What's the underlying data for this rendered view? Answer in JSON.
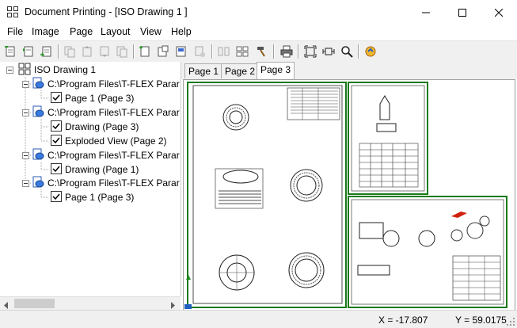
{
  "window": {
    "title": "Document Printing - [ISO Drawing 1 ]"
  },
  "menu": [
    "File",
    "Image",
    "Page",
    "Layout",
    "View",
    "Help"
  ],
  "tree": {
    "root": "ISO Drawing 1",
    "items": [
      {
        "label": "C:\\Program Files\\T-FLEX Parar",
        "type": "document"
      },
      {
        "label": "Page 1 (Page 3)",
        "type": "page"
      },
      {
        "label": "C:\\Program Files\\T-FLEX Parar",
        "type": "document"
      },
      {
        "label": "Drawing (Page 3)",
        "type": "page"
      },
      {
        "label": "Exploded View (Page 2)",
        "type": "page"
      },
      {
        "label": "C:\\Program Files\\T-FLEX Parar",
        "type": "document"
      },
      {
        "label": "Drawing (Page 1)",
        "type": "page"
      },
      {
        "label": "C:\\Program Files\\T-FLEX Parar",
        "type": "document"
      },
      {
        "label": "Page 1 (Page 3)",
        "type": "page"
      }
    ]
  },
  "tabs": [
    {
      "label": "Page 1",
      "active": false
    },
    {
      "label": "Page 2",
      "active": false
    },
    {
      "label": "Page 3",
      "active": true
    }
  ],
  "status": {
    "x": "X = -17.807",
    "y": "Y = 59.0175"
  },
  "colors": {
    "frame_green": "#1a7a1a",
    "accent_blue": "#2060c0",
    "highlight_red": "#d02010"
  }
}
